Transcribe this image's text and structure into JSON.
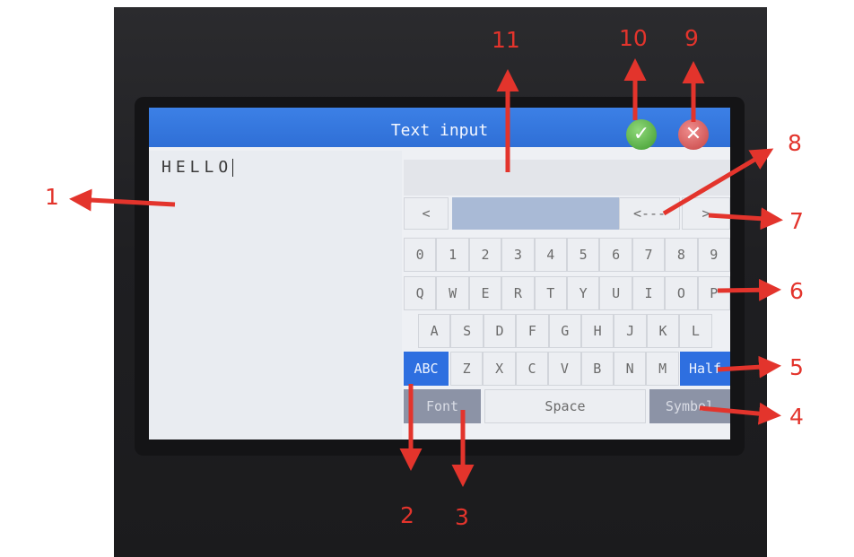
{
  "window": {
    "title": "Text input"
  },
  "buttons": {
    "ok_icon": "check-icon",
    "cancel_icon": "close-icon"
  },
  "input": {
    "text": "HELLO"
  },
  "nav": {
    "prev": "<",
    "next": ">",
    "backspace": "<---"
  },
  "keyboard": {
    "row_numbers": [
      "0",
      "1",
      "2",
      "3",
      "4",
      "5",
      "6",
      "7",
      "8",
      "9"
    ],
    "row_q": [
      "Q",
      "W",
      "E",
      "R",
      "T",
      "Y",
      "U",
      "I",
      "O",
      "P"
    ],
    "row_a": [
      "A",
      "S",
      "D",
      "F",
      "G",
      "H",
      "J",
      "K",
      "L"
    ],
    "row_z": [
      "Z",
      "X",
      "C",
      "V",
      "B",
      "N",
      "M"
    ],
    "abc": "ABC",
    "half": "Half",
    "font": "Font",
    "space": "Space",
    "symbol": "Symbol"
  },
  "annotations": [
    "1",
    "2",
    "3",
    "4",
    "5",
    "6",
    "7",
    "8",
    "9",
    "10",
    "11"
  ],
  "colors": {
    "accent": "#2e6fe0",
    "annotation": "#e3342c"
  }
}
